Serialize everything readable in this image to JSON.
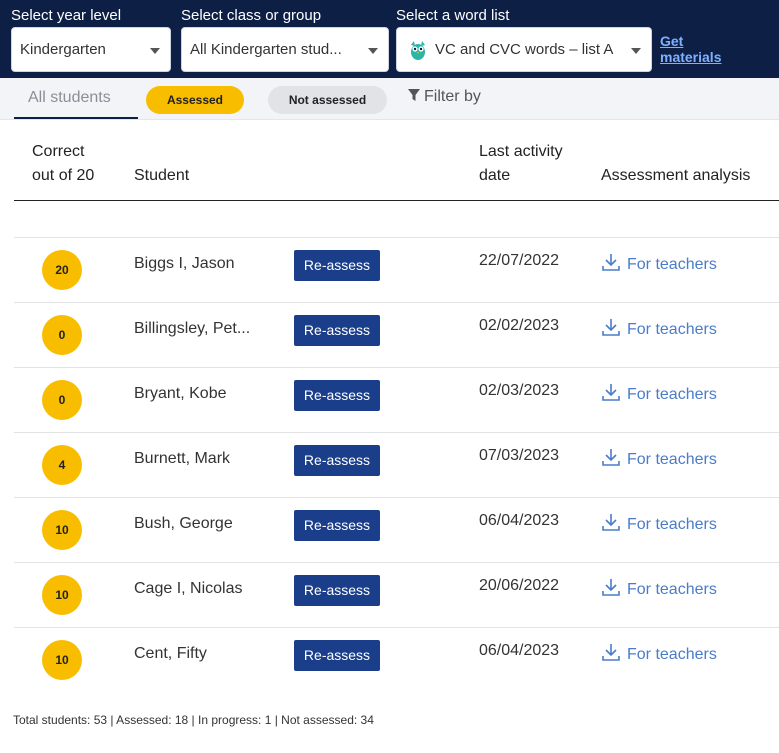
{
  "filters": {
    "year_label": "Select year level",
    "year_value": "Kindergarten",
    "class_label": "Select class or group",
    "class_value": "All Kindergarten stud...",
    "list_label": "Select a word list",
    "list_value": "VC and CVC words – list A",
    "get_materials": "Get materials"
  },
  "tabs": {
    "all": "All students",
    "assessed": "Assessed",
    "not_assessed": "Not assessed",
    "filter": "Filter by"
  },
  "columns": {
    "correct_1": "Correct",
    "correct_2": "out of 20",
    "student": "Student",
    "date_1": "Last activity",
    "date_2": "date",
    "analysis": "Assessment analysis"
  },
  "reassess_label": "Re-assess",
  "teachers_label": "For teachers",
  "rows": [
    {
      "score": "20",
      "name": "Biggs I, Jason",
      "date": "22/07/2022"
    },
    {
      "score": "0",
      "name": "Billingsley, Pet...",
      "date": "02/02/2023"
    },
    {
      "score": "0",
      "name": "Bryant, Kobe",
      "date": "02/03/2023"
    },
    {
      "score": "4",
      "name": "Burnett, Mark",
      "date": "07/03/2023"
    },
    {
      "score": "10",
      "name": "Bush, George",
      "date": "06/04/2023"
    },
    {
      "score": "10",
      "name": "Cage I, Nicolas",
      "date": "20/06/2022"
    },
    {
      "score": "10",
      "name": "Cent, Fifty",
      "date": "06/04/2023"
    }
  ],
  "footer": "Total students: 53 | Assessed: 18 | In progress: 1 | Not assessed: 34",
  "colors": {
    "navy": "#0d1f45",
    "accent": "#f9bd00",
    "button": "#1b3e8a",
    "link": "#4a7cc9"
  }
}
